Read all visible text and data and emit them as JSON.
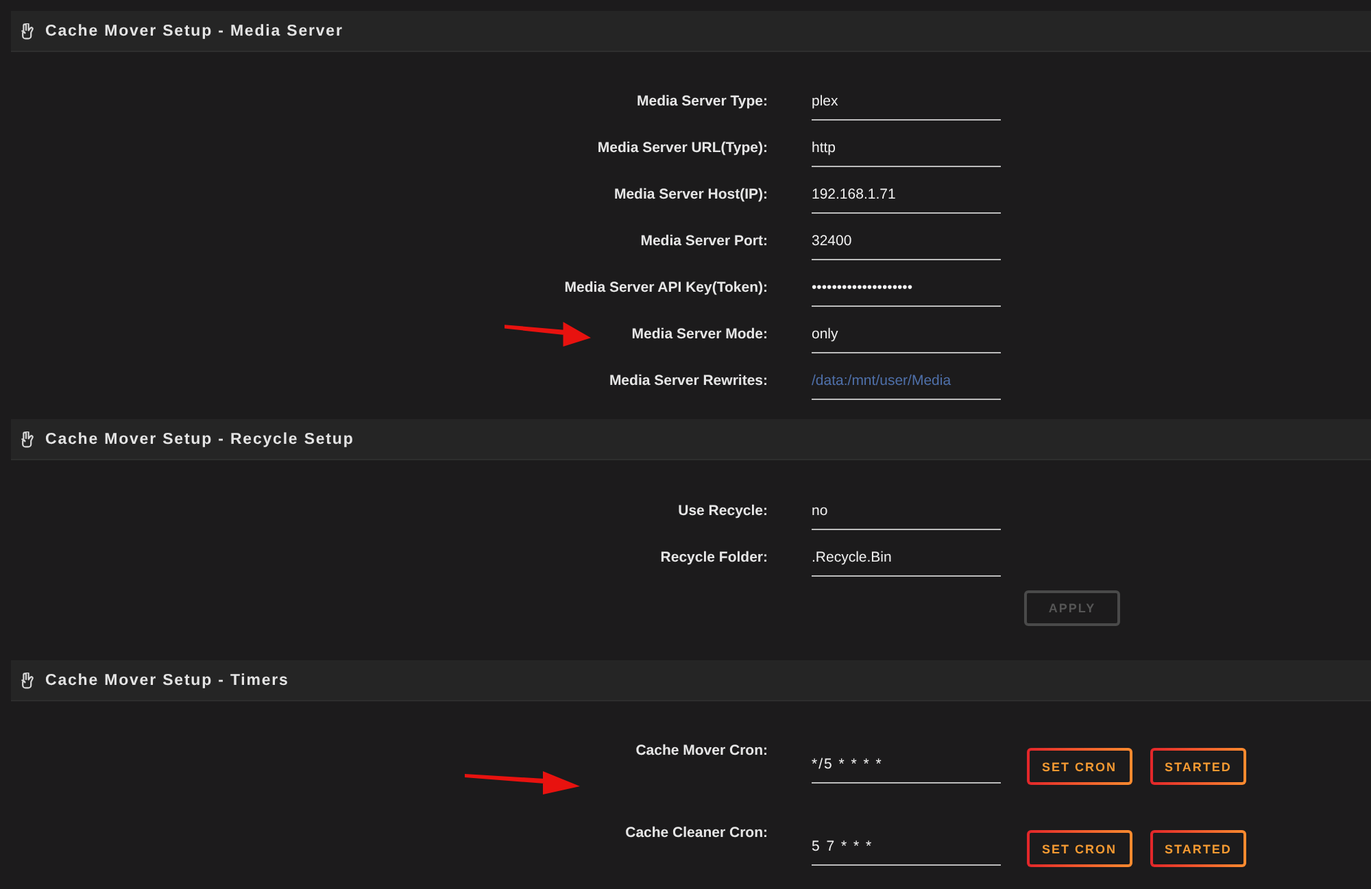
{
  "sections": [
    {
      "title": "Cache Mover Setup - Media Server",
      "kind": "settings",
      "fields": [
        {
          "label": "Media Server Type:",
          "value": "plex",
          "marked": false
        },
        {
          "label": "Media Server URL(Type):",
          "value": "http",
          "marked": false
        },
        {
          "label": "Media Server Host(IP):",
          "value": "192.168.1.71",
          "marked": false
        },
        {
          "label": "Media Server Port:",
          "value": "32400",
          "marked": false
        },
        {
          "label": "Media Server API Key(Token):",
          "value": "••••••••••••••••••••",
          "marked": false
        },
        {
          "label": "Media Server Mode:",
          "value": "only",
          "marked": true
        },
        {
          "label": "Media Server Rewrites:",
          "placeholder": "/data:/mnt/user/Media",
          "marked": false
        }
      ]
    },
    {
      "title": "Cache Mover Setup - Recycle Setup",
      "kind": "settings",
      "fields": [
        {
          "label": "Use Recycle:",
          "value": "no",
          "marked": false
        },
        {
          "label": "Recycle Folder:",
          "value": ".Recycle.Bin",
          "marked": false
        }
      ],
      "buttons": [
        {
          "label": "APPLY",
          "disabled": true
        }
      ]
    },
    {
      "title": "Cache Mover Setup - Timers",
      "kind": "timers",
      "fields": [
        {
          "label": "Cache Mover Cron:",
          "value": "*/5 * * * *",
          "marked": true,
          "buttons": [
            {
              "label": "SET CRON",
              "disabled": false
            },
            {
              "label": "STARTED",
              "disabled": false
            }
          ]
        },
        {
          "label": "Cache Cleaner Cron:",
          "value": "5 7 * * *",
          "marked": false,
          "buttons": [
            {
              "label": "SET CRON",
              "disabled": false
            },
            {
              "label": "STARTED",
              "disabled": false
            }
          ]
        }
      ]
    }
  ]
}
